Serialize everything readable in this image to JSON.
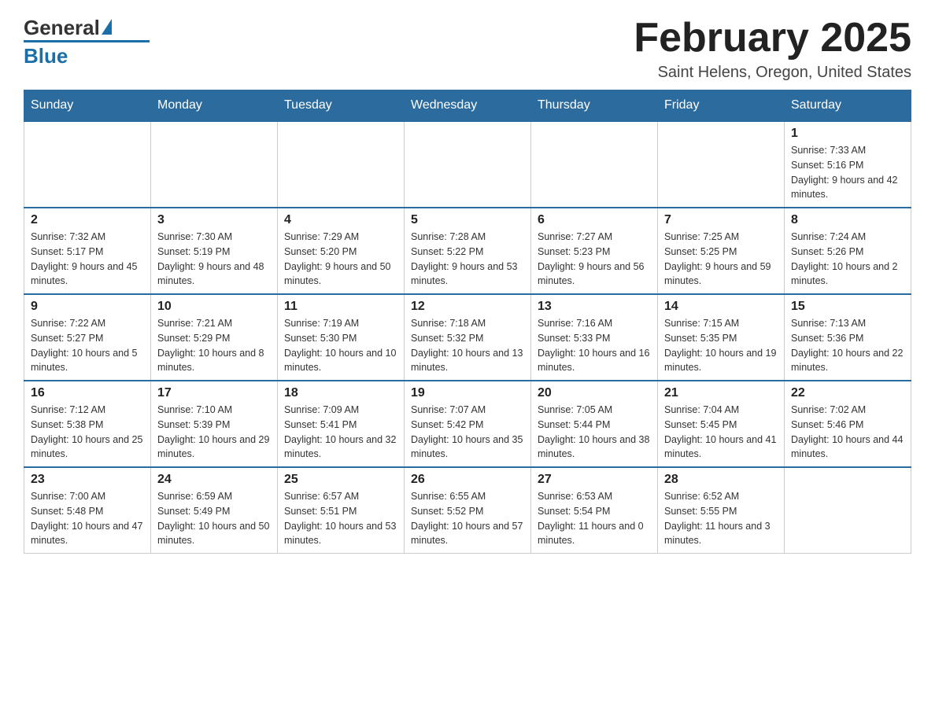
{
  "header": {
    "logo_general": "General",
    "logo_blue": "Blue",
    "month_title": "February 2025",
    "location": "Saint Helens, Oregon, United States"
  },
  "calendar": {
    "days_of_week": [
      "Sunday",
      "Monday",
      "Tuesday",
      "Wednesday",
      "Thursday",
      "Friday",
      "Saturday"
    ],
    "weeks": [
      [
        {
          "day": "",
          "info": ""
        },
        {
          "day": "",
          "info": ""
        },
        {
          "day": "",
          "info": ""
        },
        {
          "day": "",
          "info": ""
        },
        {
          "day": "",
          "info": ""
        },
        {
          "day": "",
          "info": ""
        },
        {
          "day": "1",
          "info": "Sunrise: 7:33 AM\nSunset: 5:16 PM\nDaylight: 9 hours and 42 minutes."
        }
      ],
      [
        {
          "day": "2",
          "info": "Sunrise: 7:32 AM\nSunset: 5:17 PM\nDaylight: 9 hours and 45 minutes."
        },
        {
          "day": "3",
          "info": "Sunrise: 7:30 AM\nSunset: 5:19 PM\nDaylight: 9 hours and 48 minutes."
        },
        {
          "day": "4",
          "info": "Sunrise: 7:29 AM\nSunset: 5:20 PM\nDaylight: 9 hours and 50 minutes."
        },
        {
          "day": "5",
          "info": "Sunrise: 7:28 AM\nSunset: 5:22 PM\nDaylight: 9 hours and 53 minutes."
        },
        {
          "day": "6",
          "info": "Sunrise: 7:27 AM\nSunset: 5:23 PM\nDaylight: 9 hours and 56 minutes."
        },
        {
          "day": "7",
          "info": "Sunrise: 7:25 AM\nSunset: 5:25 PM\nDaylight: 9 hours and 59 minutes."
        },
        {
          "day": "8",
          "info": "Sunrise: 7:24 AM\nSunset: 5:26 PM\nDaylight: 10 hours and 2 minutes."
        }
      ],
      [
        {
          "day": "9",
          "info": "Sunrise: 7:22 AM\nSunset: 5:27 PM\nDaylight: 10 hours and 5 minutes."
        },
        {
          "day": "10",
          "info": "Sunrise: 7:21 AM\nSunset: 5:29 PM\nDaylight: 10 hours and 8 minutes."
        },
        {
          "day": "11",
          "info": "Sunrise: 7:19 AM\nSunset: 5:30 PM\nDaylight: 10 hours and 10 minutes."
        },
        {
          "day": "12",
          "info": "Sunrise: 7:18 AM\nSunset: 5:32 PM\nDaylight: 10 hours and 13 minutes."
        },
        {
          "day": "13",
          "info": "Sunrise: 7:16 AM\nSunset: 5:33 PM\nDaylight: 10 hours and 16 minutes."
        },
        {
          "day": "14",
          "info": "Sunrise: 7:15 AM\nSunset: 5:35 PM\nDaylight: 10 hours and 19 minutes."
        },
        {
          "day": "15",
          "info": "Sunrise: 7:13 AM\nSunset: 5:36 PM\nDaylight: 10 hours and 22 minutes."
        }
      ],
      [
        {
          "day": "16",
          "info": "Sunrise: 7:12 AM\nSunset: 5:38 PM\nDaylight: 10 hours and 25 minutes."
        },
        {
          "day": "17",
          "info": "Sunrise: 7:10 AM\nSunset: 5:39 PM\nDaylight: 10 hours and 29 minutes."
        },
        {
          "day": "18",
          "info": "Sunrise: 7:09 AM\nSunset: 5:41 PM\nDaylight: 10 hours and 32 minutes."
        },
        {
          "day": "19",
          "info": "Sunrise: 7:07 AM\nSunset: 5:42 PM\nDaylight: 10 hours and 35 minutes."
        },
        {
          "day": "20",
          "info": "Sunrise: 7:05 AM\nSunset: 5:44 PM\nDaylight: 10 hours and 38 minutes."
        },
        {
          "day": "21",
          "info": "Sunrise: 7:04 AM\nSunset: 5:45 PM\nDaylight: 10 hours and 41 minutes."
        },
        {
          "day": "22",
          "info": "Sunrise: 7:02 AM\nSunset: 5:46 PM\nDaylight: 10 hours and 44 minutes."
        }
      ],
      [
        {
          "day": "23",
          "info": "Sunrise: 7:00 AM\nSunset: 5:48 PM\nDaylight: 10 hours and 47 minutes."
        },
        {
          "day": "24",
          "info": "Sunrise: 6:59 AM\nSunset: 5:49 PM\nDaylight: 10 hours and 50 minutes."
        },
        {
          "day": "25",
          "info": "Sunrise: 6:57 AM\nSunset: 5:51 PM\nDaylight: 10 hours and 53 minutes."
        },
        {
          "day": "26",
          "info": "Sunrise: 6:55 AM\nSunset: 5:52 PM\nDaylight: 10 hours and 57 minutes."
        },
        {
          "day": "27",
          "info": "Sunrise: 6:53 AM\nSunset: 5:54 PM\nDaylight: 11 hours and 0 minutes."
        },
        {
          "day": "28",
          "info": "Sunrise: 6:52 AM\nSunset: 5:55 PM\nDaylight: 11 hours and 3 minutes."
        },
        {
          "day": "",
          "info": ""
        }
      ]
    ]
  }
}
